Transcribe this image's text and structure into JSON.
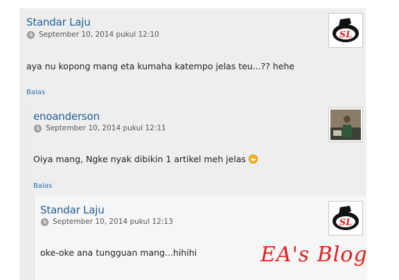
{
  "comments": [
    {
      "author": "Standar Laju",
      "date": "September 10, 2014 pukul 12:10",
      "text": "aya nu kopong mang eta kumaha katempo jelas teu...?? hehe",
      "reply_label": "Balas",
      "avatar": "biker-logo"
    },
    {
      "author": "enoanderson",
      "date": "September 10, 2014 pukul 12:11",
      "text": "Oiya mang, Ngke nyak dibikin 1 artikel meh jelas",
      "emoticon": "smiley-icon",
      "reply_label": "Balas",
      "avatar": "photo"
    },
    {
      "author": "Standar Laju",
      "date": "September 10, 2014 pukul 12:13",
      "text": "oke-oke ana tungguan mang...hihihi",
      "avatar": "biker-logo"
    }
  ],
  "watermark": "EA's Blog",
  "colors": {
    "author": "#1f5f98",
    "panel": "#eeeeee",
    "watermark": "#e01f1f"
  }
}
